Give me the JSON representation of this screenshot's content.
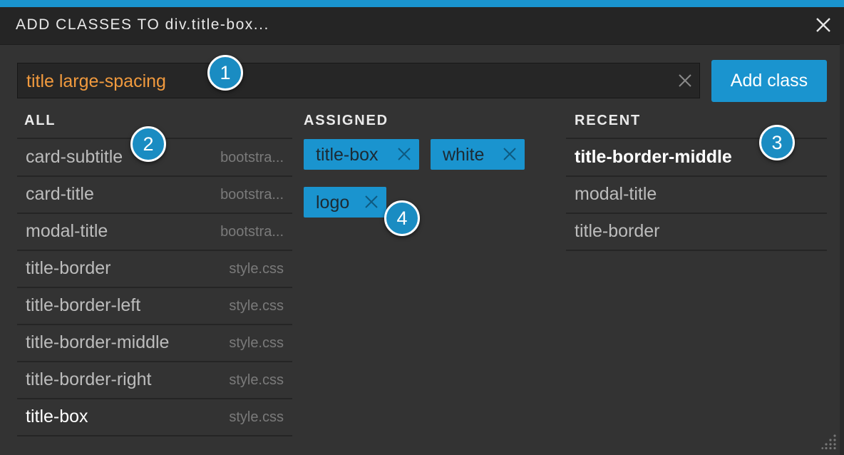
{
  "window": {
    "title": "ADD CLASSES TO div.title-box...",
    "close_icon": "close-icon",
    "accent": "#1a94cf"
  },
  "search": {
    "value": "title large-spacing",
    "value_color": "#f19a3e",
    "clear_icon": "clear-icon"
  },
  "add_button": {
    "label": "Add class"
  },
  "columns": {
    "all": "ALL",
    "assigned": "ASSIGNED",
    "recent": "RECENT"
  },
  "all_classes": [
    {
      "name": "card-subtitle",
      "source": "bootstra..."
    },
    {
      "name": "card-title",
      "source": "bootstra..."
    },
    {
      "name": "modal-title",
      "source": "bootstra..."
    },
    {
      "name": "title-border",
      "source": "style.css"
    },
    {
      "name": "title-border-left",
      "source": "style.css"
    },
    {
      "name": "title-border-middle",
      "source": "style.css"
    },
    {
      "name": "title-border-right",
      "source": "style.css"
    },
    {
      "name": "title-box",
      "source": "style.css"
    }
  ],
  "assigned": [
    {
      "name": "title-box"
    },
    {
      "name": "white"
    },
    {
      "name": "logo"
    }
  ],
  "recent": [
    {
      "name": "title-border-middle"
    },
    {
      "name": "modal-title"
    },
    {
      "name": "title-border"
    }
  ],
  "badges": [
    "1",
    "2",
    "3",
    "4"
  ]
}
